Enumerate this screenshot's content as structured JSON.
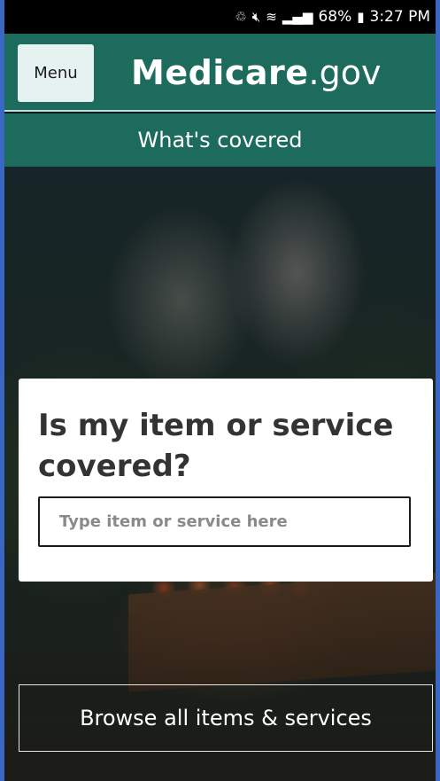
{
  "status_bar": {
    "icons": [
      "recycle-icon",
      "mute-icon",
      "wifi-icon",
      "signal-icon",
      "battery-icon"
    ],
    "battery": "68%",
    "time": "3:27 PM"
  },
  "header": {
    "menu_label": "Menu",
    "logo_bold": "Medicare",
    "logo_light": ".gov",
    "brand_color": "#1c6b5d"
  },
  "subnav": {
    "label": "What's covered"
  },
  "search": {
    "title": "Is my item or service covered?",
    "placeholder": "Type item or service here",
    "value": ""
  },
  "browse": {
    "label": "Browse all items & services"
  }
}
